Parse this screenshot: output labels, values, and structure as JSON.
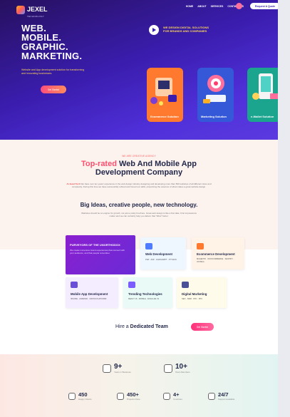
{
  "header": {
    "logo_text": "JEXEL",
    "logo_sub": "TECHNOLOGY",
    "nav": [
      "HOME",
      "ABOUT",
      "SERVICES",
      "CONTACT US"
    ],
    "cta": "Request A Quote"
  },
  "hero": {
    "headline": [
      "WEB.",
      "MOBILE.",
      "GRAPHIC.",
      "MARKETING."
    ],
    "subtext": "Website and App development solution for transforming and innovating businesses.",
    "button": "Get Started",
    "tagline": [
      "WE DESIGN DIGITAL SOLUTIONS",
      "FOR BRANDS AND COMPANIES"
    ],
    "cards": [
      {
        "label": "Ecommerce Solution",
        "color": "#ff7a2e"
      },
      {
        "label": "Marketing Solution",
        "color": "#3458d8"
      },
      {
        "label": "e-Wallet Solution",
        "color": "#1ba58f"
      }
    ]
  },
  "about": {
    "kicker": "WE ARE CREATIVE AGENCY",
    "title_highlight": "Top-rated",
    "title_rest": "Web And Mobile App",
    "title_line2": "Development Company",
    "para_brand": "At Jexel Tech",
    "para_text": "We have over ten years' experience in the web design industry designing and developing more than 500 websites of all different sizes and complexity. During this time we have successfully refined and honed our skills, pinpointing the essence of what makes a great website design.",
    "big_ideas": "Big Ideas, creative people, new technology.",
    "para2": "Websites should be an engine for growth, not just a pretty brochure. Great web design is like a first date. First impressions matter and we can certainly help you deliver that \"Wow\" factor."
  },
  "services": {
    "lead_title": "PURVEYORS OF THE UNORTHODOX",
    "lead_text": "We create immersive brand experiences that connect with your audience, and that people remember.",
    "items": [
      {
        "title": "Web Development",
        "tags": "PHP · ASP · JAVASCRIPT · PYTHON",
        "color": "#4f7cff"
      },
      {
        "title": "Ecommerce Development",
        "tags": "MAGENTO · WOOCOMMERCE · SHOPIFY · JOOMLA",
        "color": "#ff7a2e"
      },
      {
        "title": "Mobile App Development",
        "tags": "IPHONE · ANDROID · CROSS PLATFORM",
        "color": "#6c4fd8"
      },
      {
        "title": "Trending Technologies",
        "tags": "REACT JS · MOBILE · ANGULAR JS",
        "color": "#7a5cff"
      },
      {
        "title": "Digital Marketing",
        "tags": "SEO · SMM · PPC · PPC",
        "color": "#4a4f9a"
      }
    ],
    "hire_prefix": "Hire a",
    "hire_bold": "Dedicated Team",
    "hire_button": "Get Started"
  },
  "stats": {
    "top": [
      {
        "value": "9+",
        "label": "Years in Business",
        "icon": "rocket-icon"
      },
      {
        "value": "10+",
        "label": "Team Members",
        "icon": "team-icon"
      }
    ],
    "bottom": [
      {
        "value": "450",
        "label": "Happy Clients",
        "icon": "handshake-icon"
      },
      {
        "value": "450+",
        "label": "Projects Done",
        "icon": "projects-icon"
      },
      {
        "value": "4+",
        "label": "Countries",
        "icon": "countries-icon"
      },
      {
        "value": "24/7",
        "label": "Support Available",
        "icon": "support-icon"
      }
    ]
  }
}
